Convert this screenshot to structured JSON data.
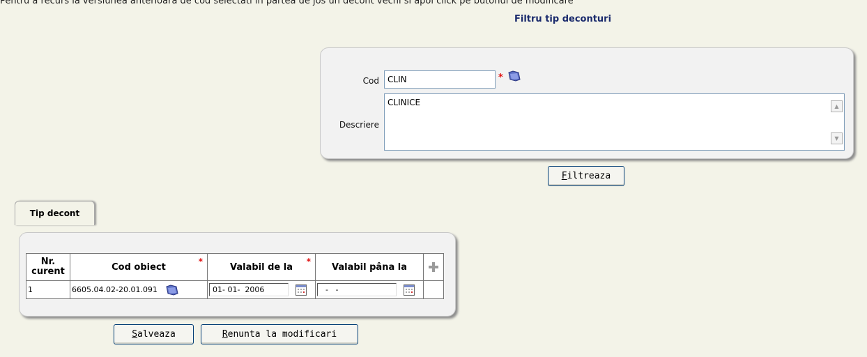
{
  "page": {
    "top_banner": "Pentru a recurs la versiunea anterioara de cod selectati in partea de jos un decont vechi si apoi click pe butonul de modificare",
    "title": "Filtru tip deconturi"
  },
  "filter": {
    "cod_label": "Cod",
    "cod_value": "CLIN",
    "descriere_label": "Descriere",
    "descriere_value": "CLINICE",
    "filter_button": {
      "underline": "F",
      "rest": "iltreaza"
    }
  },
  "tab": {
    "label": "Tip decont"
  },
  "grid": {
    "headers": {
      "nr": "Nr. curent",
      "cod": "Cod obiect",
      "valabil_de": "Valabil de la",
      "valabil_pana": "Valabil pâna la"
    },
    "rows": [
      {
        "nr": "1",
        "cod": "6605.04.02-20.01.091",
        "valabil_de": "01- 01-  2006",
        "valabil_pana": "  -   -"
      }
    ]
  },
  "actions": {
    "save": {
      "underline": "S",
      "rest": "alveaza"
    },
    "cancel": {
      "underline": "R",
      "rest": "enunta la modificari"
    }
  },
  "colors": {
    "title": "#1a2a6c",
    "required": "#e01010",
    "button_border": "#003c74",
    "background": "#f3f3e8"
  }
}
